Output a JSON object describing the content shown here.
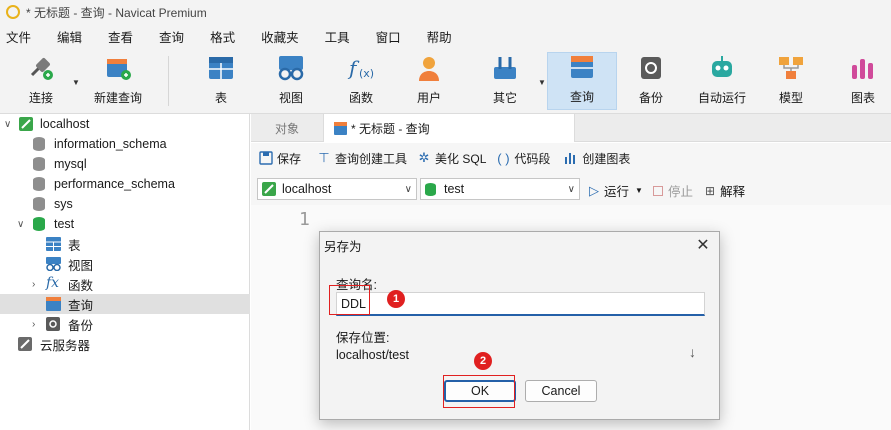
{
  "window": {
    "title": "* 无标题 - 查询 - Navicat Premium"
  },
  "menu": [
    "文件",
    "编辑",
    "查看",
    "查询",
    "格式",
    "收藏夹",
    "工具",
    "窗口",
    "帮助"
  ],
  "toolbar": {
    "items": [
      {
        "label": "连接",
        "icon": "plug-icon"
      },
      {
        "label": "新建查询",
        "icon": "new-query-icon"
      },
      {
        "label": "表",
        "icon": "table-icon"
      },
      {
        "label": "视图",
        "icon": "view-icon"
      },
      {
        "label": "函数",
        "icon": "function-icon"
      },
      {
        "label": "用户",
        "icon": "user-icon"
      },
      {
        "label": "其它",
        "icon": "tools-icon"
      },
      {
        "label": "查询",
        "icon": "query-icon",
        "active": true
      },
      {
        "label": "备份",
        "icon": "backup-icon"
      },
      {
        "label": "自动运行",
        "icon": "robot-icon"
      },
      {
        "label": "模型",
        "icon": "model-icon"
      },
      {
        "label": "图表",
        "icon": "chart-icon"
      }
    ]
  },
  "sidebar": {
    "connection": "localhost",
    "databases": [
      "information_schema",
      "mysql",
      "performance_schema",
      "sys",
      "test"
    ],
    "test_children": [
      "表",
      "视图",
      "函数",
      "查询",
      "备份"
    ],
    "cloud": "云服务器"
  },
  "tabs": {
    "objects": "对象",
    "query": "* 无标题 - 查询"
  },
  "query_toolbar": {
    "save": "保存",
    "builder": "查询创建工具",
    "beautify": "美化 SQL",
    "snippet": "代码段",
    "create_chart": "创建图表"
  },
  "connection_bar": {
    "connection": "localhost",
    "database": "test",
    "run": "运行",
    "stop": "停止",
    "explain": "解释"
  },
  "editor": {
    "line_number": "1"
  },
  "dialog": {
    "title": "另存为",
    "name_label": "查询名:",
    "name_value": "DDL",
    "location_label": "保存位置:",
    "location_value": "localhost/test",
    "ok": "OK",
    "cancel": "Cancel"
  },
  "annotations": [
    "1",
    "2"
  ],
  "colors": {
    "accent": "#2460a8",
    "active_tool": "#cfe3f5",
    "annotation_red": "#e02020",
    "db_green": "#2aa84a",
    "connection_green": "#3aa64a"
  }
}
